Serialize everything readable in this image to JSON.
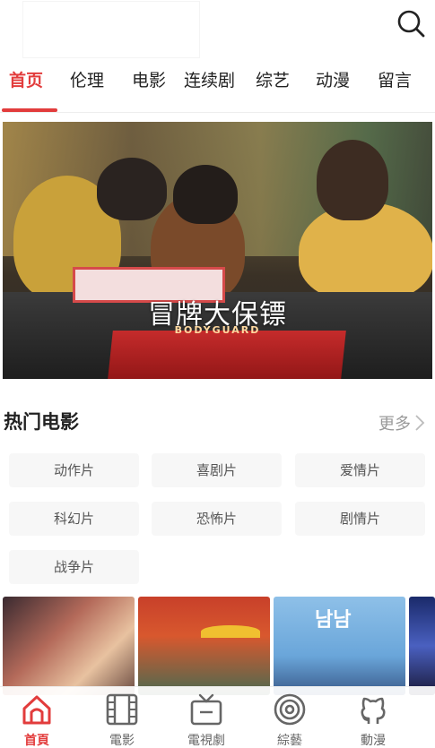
{
  "header": {
    "search_icon": "search-icon"
  },
  "tabs": [
    {
      "label": "首页",
      "active": true
    },
    {
      "label": "伦理",
      "active": false
    },
    {
      "label": "电影",
      "active": false
    },
    {
      "label": "连续剧",
      "active": false
    },
    {
      "label": "综艺",
      "active": false
    },
    {
      "label": "动漫",
      "active": false
    },
    {
      "label": "留言",
      "active": false
    }
  ],
  "banner": {
    "caption": "冒牌大保镖",
    "poster_subtitle": "BODYGUARD"
  },
  "section": {
    "title": "热门电影",
    "more_label": "更多"
  },
  "genres": [
    {
      "label": "动作片"
    },
    {
      "label": "喜剧片"
    },
    {
      "label": "爱情片"
    },
    {
      "label": "科幻片"
    },
    {
      "label": "恐怖片"
    },
    {
      "label": "剧情片"
    },
    {
      "label": "战争片"
    }
  ],
  "thumbnails": [
    {
      "name": "movie-thumbnail-1"
    },
    {
      "name": "movie-thumbnail-2"
    },
    {
      "name": "movie-thumbnail-3",
      "title_text": "남남"
    },
    {
      "name": "movie-thumbnail-4"
    }
  ],
  "bottom_nav": [
    {
      "label": "首頁",
      "icon": "home-icon",
      "active": true
    },
    {
      "label": "電影",
      "icon": "film-icon",
      "active": false
    },
    {
      "label": "電視劇",
      "icon": "tv-icon",
      "active": false
    },
    {
      "label": "綜藝",
      "icon": "target-icon",
      "active": false
    },
    {
      "label": "動漫",
      "icon": "github-cat-icon",
      "active": false
    }
  ],
  "colors": {
    "accent": "#e23c3c",
    "muted_text": "#999999",
    "genre_bg": "#f7f7f7"
  }
}
